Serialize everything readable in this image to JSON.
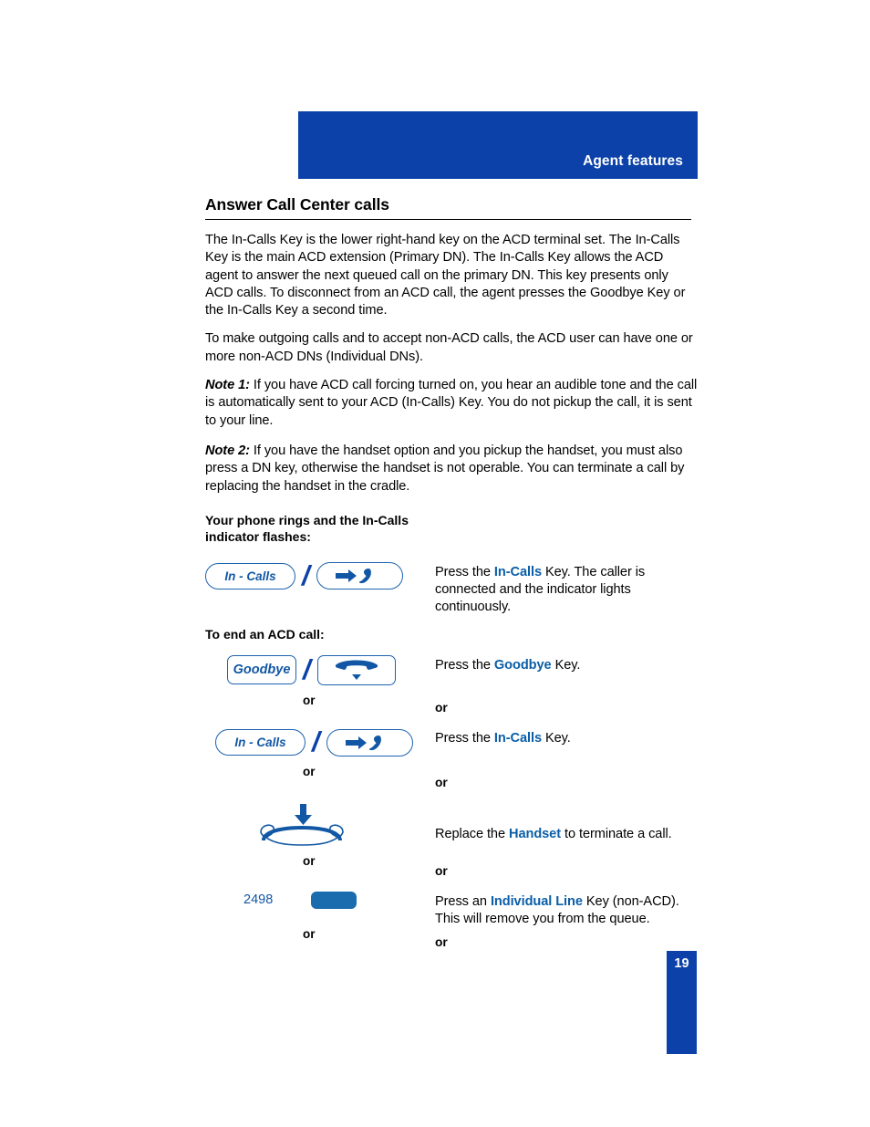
{
  "header": {
    "title": "Agent features"
  },
  "section": {
    "title": "Answer Call Center calls",
    "paragraphs": [
      "The In-Calls Key is the lower right-hand key on the ACD terminal set. The In-Calls Key is the main ACD extension (Primary DN). The In-Calls Key allows the ACD agent to answer the next queued call on the primary DN. This key presents only ACD calls. To disconnect from an ACD call, the agent presses the Goodbye Key or the In-Calls Key a second time.",
      "To make outgoing calls and to accept non-ACD calls, the ACD user can have one or more non-ACD DNs (Individual DNs)."
    ],
    "note1_label": "Note 1:",
    "note1_text": "If you have ACD call forcing turned on, you hear an audible tone and the call is automatically sent to your ACD (In-Calls) Key. You do not pickup the call, it is sent to your line.",
    "note2_label": "Note 2:",
    "note2_text": "If you have the handset option and you pickup the handset, you must also press a DN key, otherwise the handset is not operable. You can terminate a call by replacing the handset in the cradle."
  },
  "lead_ins": {
    "ringing": "Your phone rings and the In-Calls\nindicator flashes:",
    "ringing_line1": "Your phone rings and the In-Calls",
    "ringing_line2": "indicator flashes:",
    "end_call": "To end an ACD call:"
  },
  "or_label": "or",
  "steps": [
    {
      "key_label": "In - Calls",
      "icon": "incoming-call-handset-icon",
      "text_before": "Press the ",
      "keyword": "In-Calls",
      "text_after": " Key. The caller is connected and the indicator lights continuously."
    },
    {
      "key_label": "Goodbye",
      "icon": "hangup-handset-icon",
      "text_before": "Press the ",
      "keyword": "Goodbye",
      "text_after": " Key."
    },
    {
      "key_label": "In - Calls",
      "icon": "incoming-call-handset-icon",
      "text_before": "Press the ",
      "keyword": "In-Calls",
      "text_after": " Key."
    },
    {
      "key_label": "",
      "icon": "handset-cradle-icon",
      "text_before": "Replace the ",
      "keyword": "Handset",
      "text_after": " to terminate a call."
    },
    {
      "key_label": "2498",
      "icon": "line-key-icon",
      "text_before": "Press an ",
      "keyword": "Individual Line",
      "text_after": " Key (non-ACD).\nThis will remove you from the queue.",
      "text_after_line1": " Key (non-ACD).",
      "text_after_line2": "This will remove you from the queue."
    }
  ],
  "line_key": {
    "number": "2498"
  },
  "page": {
    "number": "19"
  },
  "colors": {
    "brand_blue": "#0B41A8",
    "key_blue": "#1E63AE",
    "keyword_blue": "#0B5EA8",
    "line_key_blue": "#1B6CAF"
  }
}
